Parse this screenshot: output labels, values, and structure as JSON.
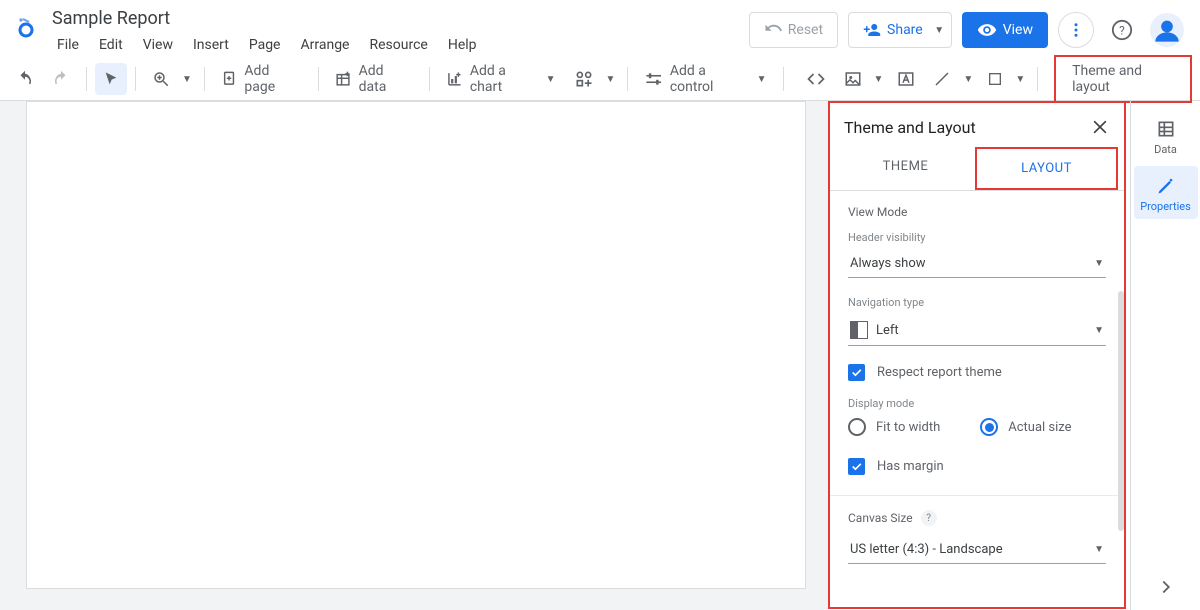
{
  "header": {
    "title": "Sample Report",
    "menu": [
      "File",
      "Edit",
      "View",
      "Insert",
      "Page",
      "Arrange",
      "Resource",
      "Help"
    ],
    "reset": "Reset",
    "share": "Share",
    "view": "View"
  },
  "toolbar": {
    "add_page": "Add page",
    "add_data": "Add data",
    "add_chart": "Add a chart",
    "add_control": "Add a control",
    "theme_layout": "Theme and layout"
  },
  "panel": {
    "title": "Theme and Layout",
    "tabs": {
      "theme": "THEME",
      "layout": "LAYOUT"
    },
    "view_mode": "View Mode",
    "header_visibility_label": "Header visibility",
    "header_visibility_value": "Always show",
    "navigation_type_label": "Navigation type",
    "navigation_type_value": "Left",
    "respect_theme": "Respect report theme",
    "display_mode_label": "Display mode",
    "fit_to_width": "Fit to width",
    "actual_size": "Actual size",
    "has_margin": "Has margin",
    "canvas_size_label": "Canvas Size",
    "canvas_size_value": "US letter (4:3) - Landscape"
  },
  "rightbar": {
    "data": "Data",
    "properties": "Properties"
  }
}
